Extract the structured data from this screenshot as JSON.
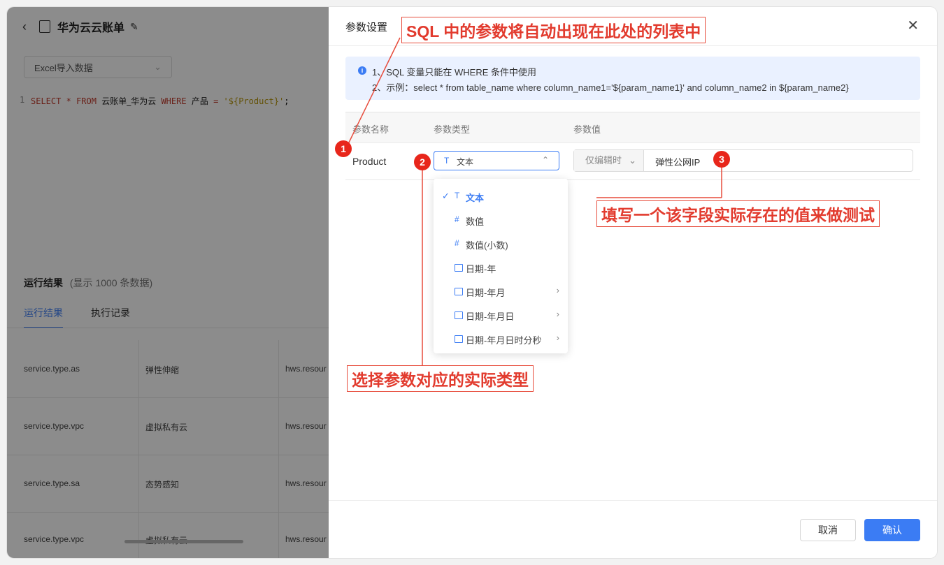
{
  "app": {
    "back_icon": "chevron-left-icon",
    "doc_title": "华为云云账单",
    "data_source": "Excel导入数据",
    "sql": {
      "line_no": "1",
      "select": "SELECT",
      "star": "*",
      "from": "FROM",
      "table": "云账单_华为云",
      "where": "WHERE",
      "field": "产品",
      "eq": "=",
      "value": "'${Product}'",
      "end": ";"
    },
    "results_title": "运行结果",
    "results_sub": "(显示 1000 条数据)",
    "tabs": [
      "运行结果",
      "执行记录"
    ],
    "rows": [
      [
        "service.type.as",
        "弹性伸缩",
        "hws.resour"
      ],
      [
        "service.type.vpc",
        "虚拟私有云",
        "hws.resour"
      ],
      [
        "service.type.sa",
        "态势感知",
        "hws.resour"
      ],
      [
        "service.type.vpc",
        "虚拟私有云",
        "hws.resour"
      ]
    ]
  },
  "drawer": {
    "title": "参数设置",
    "info_lines": [
      "1、SQL 变量只能在 WHERE 条件中使用",
      "2、示例：select * from table_name where column_name1='${param_name1}' and column_name2 in ${param_name2}"
    ],
    "columns": [
      "参数名称",
      "参数类型",
      "参数值"
    ],
    "param": {
      "name": "Product",
      "type": "文本",
      "mode": "仅编辑时",
      "value": "弹性公网IP"
    },
    "type_options": [
      {
        "icon": "T",
        "label": "文本",
        "selected": true,
        "submenu": false
      },
      {
        "icon": "#",
        "label": "数值",
        "selected": false,
        "submenu": false
      },
      {
        "icon": "#",
        "label": "数值(小数)",
        "selected": false,
        "submenu": false
      },
      {
        "icon": "calendar",
        "label": "日期-年",
        "selected": false,
        "submenu": false
      },
      {
        "icon": "calendar",
        "label": "日期-年月",
        "selected": false,
        "submenu": true
      },
      {
        "icon": "calendar",
        "label": "日期-年月日",
        "selected": false,
        "submenu": true
      },
      {
        "icon": "calendar",
        "label": "日期-年月日时分秒",
        "selected": false,
        "submenu": true
      }
    ],
    "cancel": "取消",
    "confirm": "确认"
  },
  "annotations": {
    "note1": "SQL 中的参数将自动出现在此处的列表中",
    "note2": "选择参数对应的实际类型",
    "note3": "填写一个该字段实际存在的值来做测试",
    "badge1": "1",
    "badge2": "2",
    "badge3": "3",
    "color": "#e74c3c"
  }
}
